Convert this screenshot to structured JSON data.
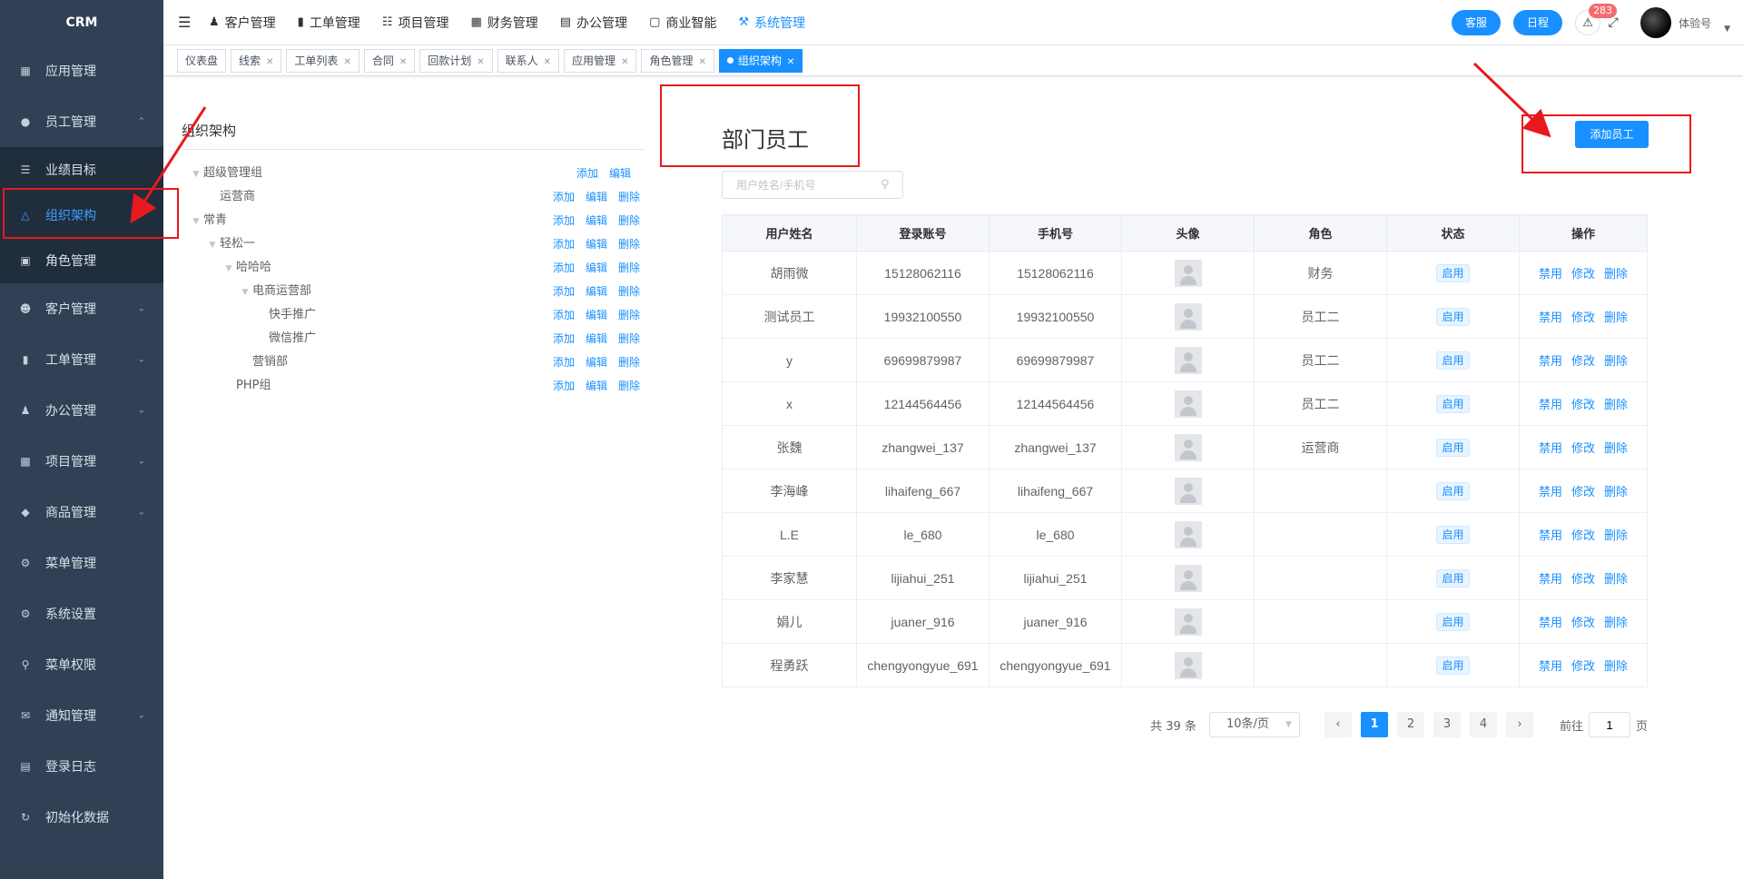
{
  "sidebar": {
    "logo": "CRM",
    "items": [
      {
        "label": "应用管理",
        "icon": "grid-icon"
      },
      {
        "label": "员工管理",
        "icon": "user-icon"
      },
      {
        "label": "客户管理",
        "icon": "customer-icon"
      },
      {
        "label": "工单管理",
        "icon": "clipboard-icon"
      },
      {
        "label": "办公管理",
        "icon": "office-icon"
      },
      {
        "label": "项目管理",
        "icon": "project-icon"
      },
      {
        "label": "商品管理",
        "icon": "box-icon"
      },
      {
        "label": "菜单管理",
        "icon": "gear-icon"
      },
      {
        "label": "系统设置",
        "icon": "settings-icon"
      },
      {
        "label": "菜单权限",
        "icon": "key-icon"
      },
      {
        "label": "通知管理",
        "icon": "notice-icon"
      },
      {
        "label": "登录日志",
        "icon": "log-icon"
      },
      {
        "label": "初始化数据",
        "icon": "refresh-icon"
      }
    ],
    "sub_items": [
      {
        "label": "业绩目标",
        "icon": "list-icon"
      },
      {
        "label": "组织架构",
        "icon": "org-icon"
      },
      {
        "label": "角色管理",
        "icon": "role-icon"
      }
    ]
  },
  "topnav": {
    "items": [
      {
        "label": "客户管理",
        "icon": "user-icon"
      },
      {
        "label": "工单管理",
        "icon": "clipboard-icon"
      },
      {
        "label": "项目管理",
        "icon": "books-icon"
      },
      {
        "label": "财务管理",
        "icon": "finance-icon"
      },
      {
        "label": "办公管理",
        "icon": "office-icon"
      },
      {
        "label": "商业智能",
        "icon": "monitor-icon"
      },
      {
        "label": "系统管理",
        "icon": "wrench-icon"
      }
    ],
    "service": "客服",
    "schedule": "日程",
    "badge": "283",
    "username": "体验号"
  },
  "tags": [
    "仪表盘",
    "线索",
    "工单列表",
    "合同",
    "回款计划",
    "联系人",
    "应用管理",
    "角色管理",
    "组织架构"
  ],
  "org": {
    "title": "组织架构",
    "add": "添加",
    "edit": "编辑",
    "del": "删除",
    "nodes": [
      {
        "name": "超级管理组",
        "level": 0,
        "expand": true,
        "del": false
      },
      {
        "name": "运营商",
        "level": 1,
        "expand": false,
        "del": true
      },
      {
        "name": "常青",
        "level": 0,
        "expand": true,
        "del": true
      },
      {
        "name": "轻松一",
        "level": 1,
        "expand": true,
        "del": true
      },
      {
        "name": "哈哈哈",
        "level": 2,
        "expand": true,
        "del": true
      },
      {
        "name": "电商运营部",
        "level": 3,
        "expand": true,
        "del": true
      },
      {
        "name": "快手推广",
        "level": 4,
        "expand": false,
        "del": true
      },
      {
        "name": "微信推广",
        "level": 4,
        "expand": false,
        "del": true
      },
      {
        "name": "营销部",
        "level": 3,
        "expand": false,
        "del": true
      },
      {
        "name": "PHP组",
        "level": 2,
        "expand": false,
        "del": true
      }
    ]
  },
  "dept": {
    "title": "部门员工",
    "add_button": "添加员工",
    "search_placeholder": "用户姓名/手机号"
  },
  "table": {
    "headers": [
      "用户姓名",
      "登录账号",
      "手机号",
      "头像",
      "角色",
      "状态",
      "操作"
    ],
    "status_label": "启用",
    "act_disable": "禁用",
    "act_edit": "修改",
    "act_delete": "删除",
    "rows": [
      {
        "name": "胡雨微",
        "account": "15128062116",
        "phone": "15128062116",
        "role": "财务"
      },
      {
        "name": "测试员工",
        "account": "19932100550",
        "phone": "19932100550",
        "role": "员工二"
      },
      {
        "name": "y",
        "account": "69699879987",
        "phone": "69699879987",
        "role": "员工二"
      },
      {
        "name": "x",
        "account": "12144564456",
        "phone": "12144564456",
        "role": "员工二"
      },
      {
        "name": "张魏",
        "account": "zhangwei_137",
        "phone": "zhangwei_137",
        "role": "运营商"
      },
      {
        "name": "李海峰",
        "account": "lihaifeng_667",
        "phone": "lihaifeng_667",
        "role": ""
      },
      {
        "name": "L.E",
        "account": "le_680",
        "phone": "le_680",
        "role": ""
      },
      {
        "name": "李家慧",
        "account": "lijiahui_251",
        "phone": "lijiahui_251",
        "role": ""
      },
      {
        "name": "娟儿",
        "account": "juaner_916",
        "phone": "juaner_916",
        "role": ""
      },
      {
        "name": "程勇跃",
        "account": "chengyongyue_691",
        "phone": "chengyongyue_691",
        "role": ""
      }
    ]
  },
  "pagination": {
    "total": "共 39 条",
    "page_size": "10条/页",
    "pages": [
      "1",
      "2",
      "3",
      "4"
    ],
    "current": "1",
    "goto_label": "前往",
    "goto_value": "1",
    "page_suffix": "页"
  },
  "colors": {
    "primary": "#1890ff",
    "sidebar": "#304156",
    "annotation": "#e8191c"
  }
}
